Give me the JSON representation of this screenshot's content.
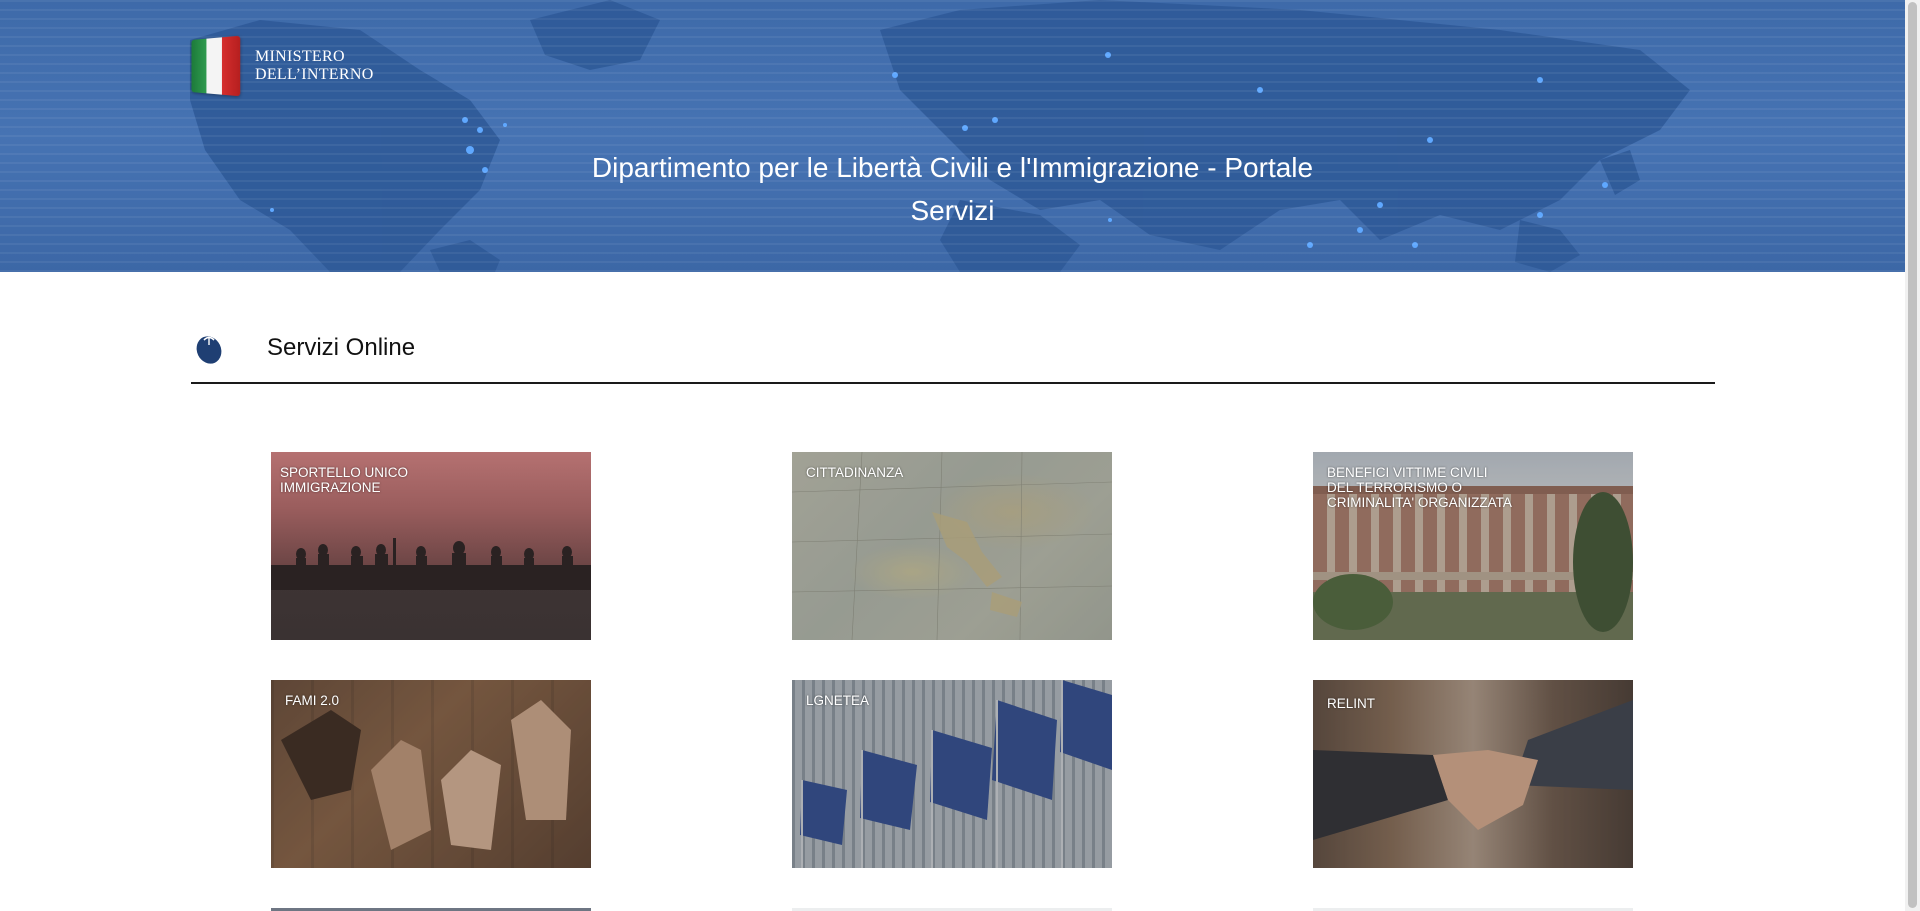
{
  "header": {
    "logo_line1": "MINISTERO",
    "logo_line2": "DELL’INTERNO",
    "title": "Dipartimento per le Libertà Civili e l'Immigrazione - Portale Servizi"
  },
  "section": {
    "icon": "computer-mouse-icon",
    "title": "Servizi Online"
  },
  "services": [
    {
      "label_line1": "SPORTELLO UNICO",
      "label_line2": "IMMIGRAZIONE",
      "label_line3": ""
    },
    {
      "label_line1": "CITTADINANZA",
      "label_line2": "",
      "label_line3": ""
    },
    {
      "label_line1": "BENEFICI VITTIME CIVILI",
      "label_line2": "DEL TERRORISMO O",
      "label_line3": "CRIMINALITA' ORGANIZZATA"
    },
    {
      "label_line1": "FAMI 2.0",
      "label_line2": "",
      "label_line3": ""
    },
    {
      "label_line1": "LGNETEA",
      "label_line2": "",
      "label_line3": ""
    },
    {
      "label_line1": "RELINT",
      "label_line2": "",
      "label_line3": ""
    }
  ],
  "colors": {
    "hero_blue": "#4673b3",
    "section_rule": "#1a1a1a",
    "icon_navy": "#1f3f73"
  }
}
